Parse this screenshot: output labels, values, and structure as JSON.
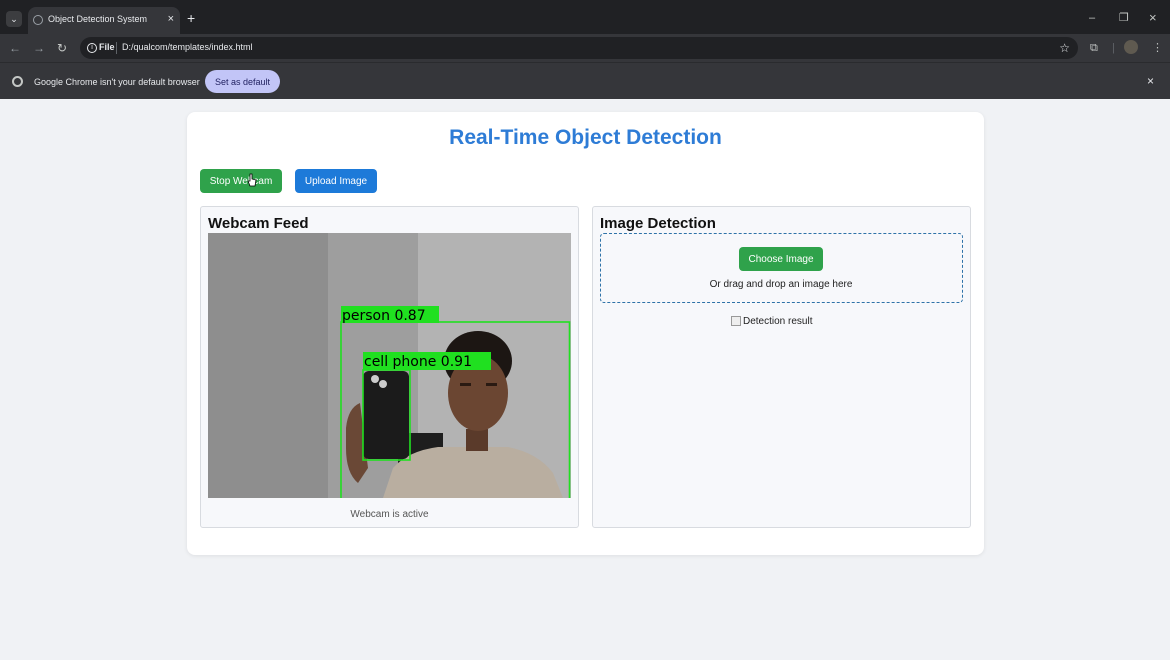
{
  "browser": {
    "tab_title": "Object Detection System",
    "scheme": "File",
    "url": "D:/qualcom/templates/index.html",
    "infobar_message": "Google Chrome isn't your default browser",
    "set_default_label": "Set as default"
  },
  "page": {
    "title": "Real-Time Object Detection",
    "buttons": {
      "stop_webcam": "Stop Webcam",
      "upload_image": "Upload Image"
    },
    "webcam_panel": {
      "title": "Webcam Feed",
      "status": "Webcam is active"
    },
    "image_panel": {
      "title": "Image Detection",
      "choose_image": "Choose Image",
      "drop_hint": "Or drag and drop an image here",
      "result_alt": "Detection result"
    }
  },
  "detections": [
    {
      "label": "person 0.87",
      "class": "person",
      "confidence": 0.87
    },
    {
      "label": "cell phone 0.91",
      "class": "cell phone",
      "confidence": 0.91
    }
  ],
  "colors": {
    "title_blue": "#2e7cd6",
    "button_green": "#2fa24b",
    "button_blue": "#1d7ad9",
    "bbox_green": "#20e020"
  }
}
